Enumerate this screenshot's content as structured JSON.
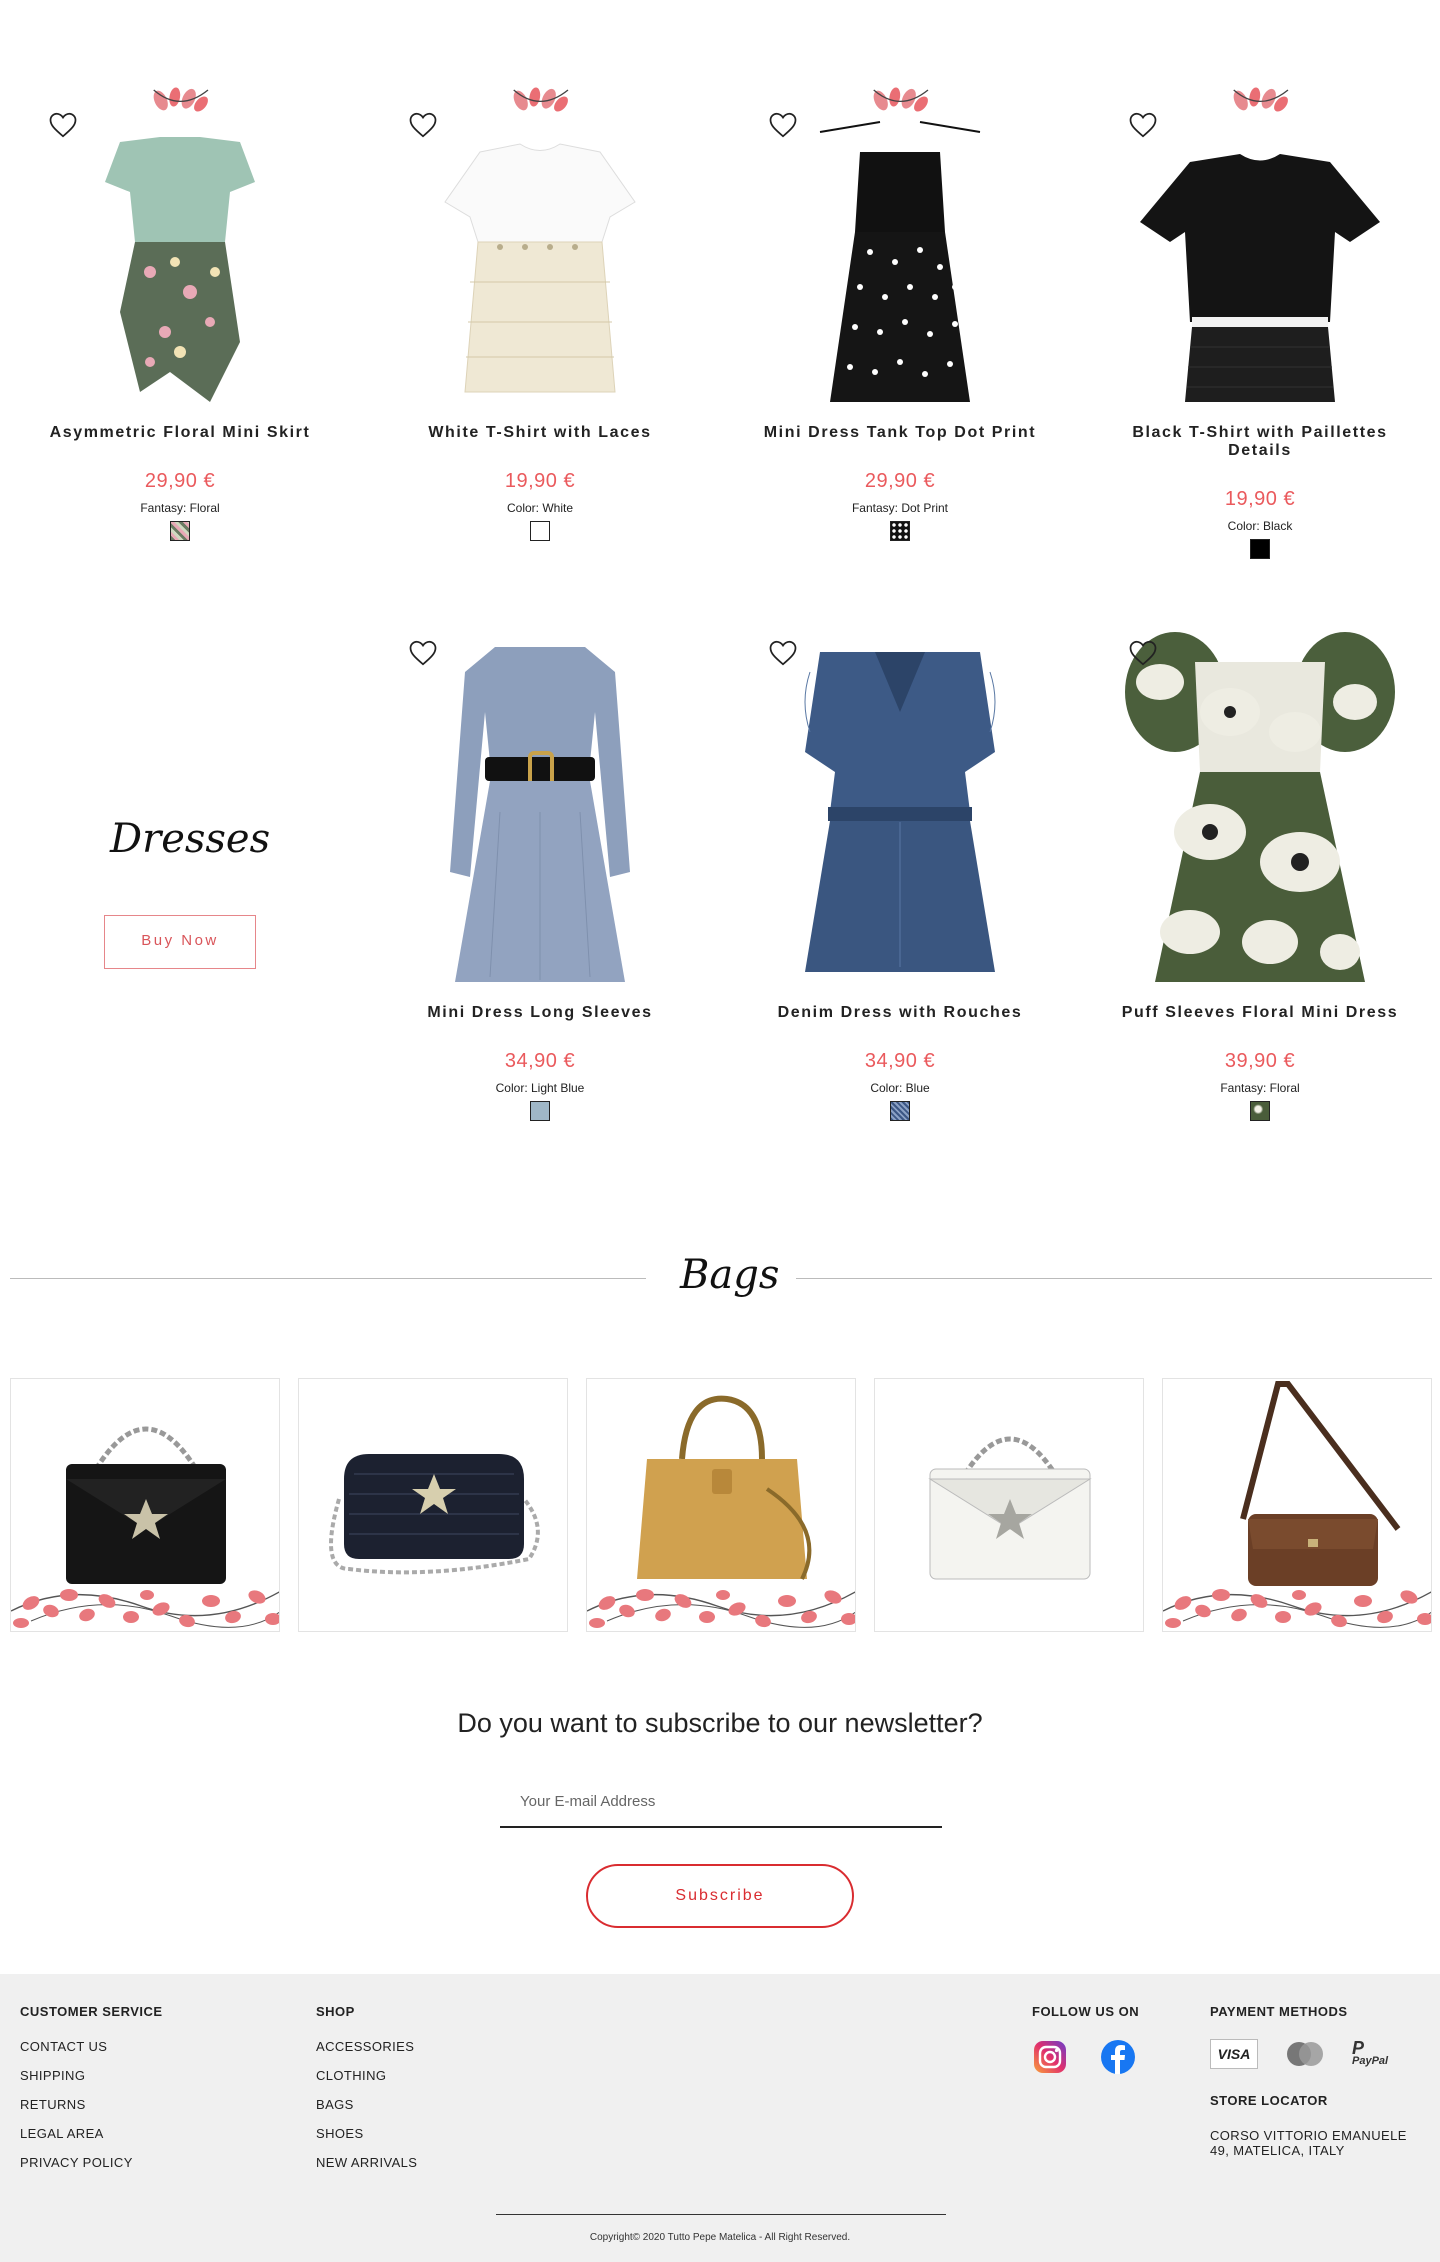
{
  "products": [
    {
      "title": "Asymmetric Floral Mini Skirt",
      "price": "29,90 €",
      "attr": "Fantasy: Floral"
    },
    {
      "title": "White T-Shirt with Laces",
      "price": "19,90 €",
      "attr": "Color: White"
    },
    {
      "title": "Mini Dress Tank Top Dot Print",
      "price": "29,90 €",
      "attr": "Fantasy: Dot Print"
    },
    {
      "title": "Black T-Shirt with Paillettes Details",
      "price": "19,90 €",
      "attr": "Color: Black"
    },
    {
      "title": "Mini Dress Long Sleeves",
      "price": "34,90 €",
      "attr": "Color: Light Blue"
    },
    {
      "title": "Denim Dress with Rouches",
      "price": "34,90 €",
      "attr": "Color: Blue"
    },
    {
      "title": "Puff Sleeves Floral Mini Dress",
      "price": "39,90 €",
      "attr": "Fantasy: Floral"
    }
  ],
  "dresses_promo": {
    "title": "Dresses",
    "button": "Buy Now"
  },
  "bags_section": {
    "title": "Bags"
  },
  "newsletter": {
    "title": "Do you want to subscribe to our newsletter?",
    "placeholder": "Your E-mail Address",
    "button": "Subscribe"
  },
  "footer": {
    "customer_service": {
      "heading": "CUSTOMER SERVICE",
      "links": [
        "CONTACT US",
        "SHIPPING",
        "RETURNS",
        "LEGAL AREA",
        "PRIVACY POLICY"
      ]
    },
    "shop": {
      "heading": "SHOP",
      "links": [
        "ACCESSORIES",
        "CLOTHING",
        "BAGS",
        "SHOES",
        "NEW ARRIVALS"
      ]
    },
    "follow": {
      "heading": "FOLLOW US ON"
    },
    "payment": {
      "heading": "PAYMENT METHODS",
      "visa": "VISA",
      "paypal": "PayPal"
    },
    "store": {
      "heading": "STORE LOCATOR",
      "address": "CORSO VITTORIO EMANUELE 49, MATELICA, ITALY"
    },
    "copyright": "Copyright© 2020 Tutto Pepe Matelica - All Right Reserved."
  },
  "colors": {
    "accent": "#ea5a5d",
    "button_red": "#d92c30",
    "footer_bg": "#f0f0f0"
  }
}
